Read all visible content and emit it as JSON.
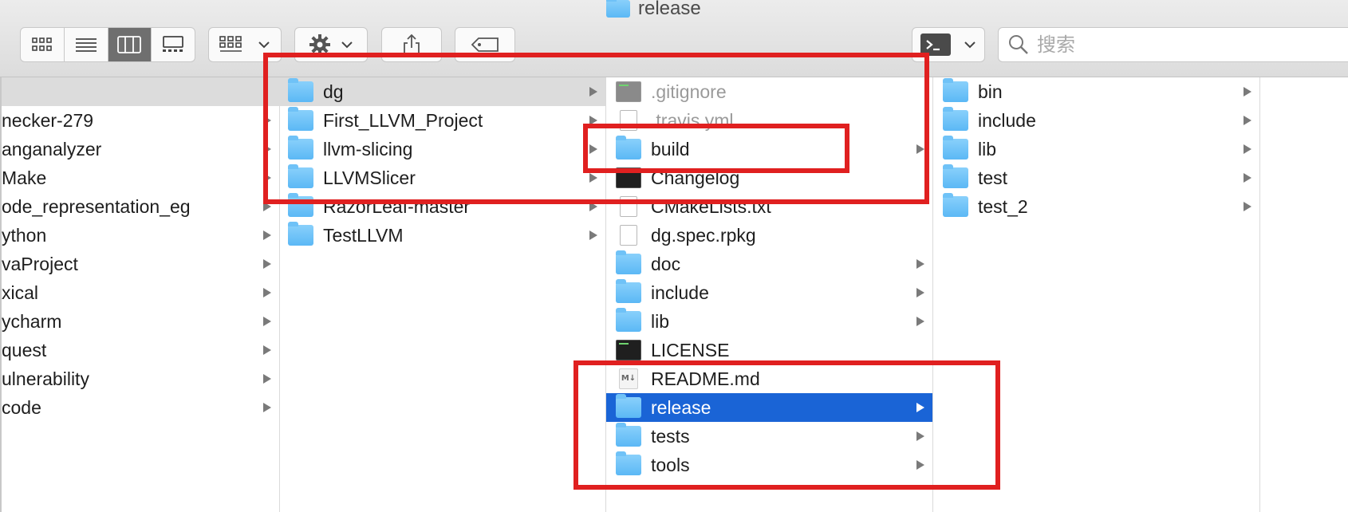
{
  "window": {
    "title": "release"
  },
  "toolbar": {
    "view_modes": [
      "icon-view",
      "list-view",
      "column-view",
      "gallery-view"
    ],
    "active_view": "column-view",
    "search_placeholder": "搜索"
  },
  "columns": [
    {
      "items": [
        {
          "name": "",
          "kind": "none",
          "arrow": false,
          "selected": "gray"
        },
        {
          "name": "necker-279",
          "kind": "none",
          "arrow": true
        },
        {
          "name": "anganalyzer",
          "kind": "none",
          "arrow": true
        },
        {
          "name": "Make",
          "kind": "none",
          "arrow": true
        },
        {
          "name": "ode_representation_eg",
          "kind": "none",
          "arrow": true
        },
        {
          "name": "ython",
          "kind": "none",
          "arrow": true
        },
        {
          "name": "vaProject",
          "kind": "none",
          "arrow": true
        },
        {
          "name": "xical",
          "kind": "none",
          "arrow": true
        },
        {
          "name": "ycharm",
          "kind": "none",
          "arrow": true
        },
        {
          "name": "quest",
          "kind": "none",
          "arrow": true
        },
        {
          "name": "ulnerability",
          "kind": "none",
          "arrow": true
        },
        {
          "name": "code",
          "kind": "none",
          "arrow": true
        }
      ]
    },
    {
      "items": [
        {
          "name": "dg",
          "kind": "folder",
          "arrow": true,
          "selected": "gray"
        },
        {
          "name": "First_LLVM_Project",
          "kind": "folder",
          "arrow": true
        },
        {
          "name": "llvm-slicing",
          "kind": "folder",
          "arrow": true
        },
        {
          "name": "LLVMSlicer",
          "kind": "folder",
          "arrow": true
        },
        {
          "name": "RazorLeaf-master",
          "kind": "folder",
          "arrow": true
        },
        {
          "name": "TestLLVM",
          "kind": "folder",
          "arrow": true
        }
      ]
    },
    {
      "items": [
        {
          "name": ".gitignore",
          "kind": "term-gray",
          "arrow": false,
          "dim": true
        },
        {
          "name": ".travis.yml",
          "kind": "doc",
          "arrow": false,
          "dim": true
        },
        {
          "name": "build",
          "kind": "folder",
          "arrow": true
        },
        {
          "name": "Changelog",
          "kind": "term",
          "arrow": false
        },
        {
          "name": "CMakeLists.txt",
          "kind": "doc",
          "arrow": false
        },
        {
          "name": "dg.spec.rpkg",
          "kind": "doc",
          "arrow": false
        },
        {
          "name": "doc",
          "kind": "folder",
          "arrow": true
        },
        {
          "name": "include",
          "kind": "folder",
          "arrow": true
        },
        {
          "name": "lib",
          "kind": "folder",
          "arrow": true
        },
        {
          "name": "LICENSE",
          "kind": "term",
          "arrow": false
        },
        {
          "name": "README.md",
          "kind": "md",
          "arrow": false
        },
        {
          "name": "release",
          "kind": "folder",
          "arrow": true,
          "selected": "blue"
        },
        {
          "name": "tests",
          "kind": "folder",
          "arrow": true
        },
        {
          "name": "tools",
          "kind": "folder",
          "arrow": true
        }
      ]
    },
    {
      "items": [
        {
          "name": "bin",
          "kind": "folder",
          "arrow": true
        },
        {
          "name": "include",
          "kind": "folder",
          "arrow": true
        },
        {
          "name": "lib",
          "kind": "folder",
          "arrow": true
        },
        {
          "name": "test",
          "kind": "folder",
          "arrow": true
        },
        {
          "name": "test_2",
          "kind": "folder",
          "arrow": true
        }
      ]
    },
    {
      "items": []
    }
  ],
  "annotation_color": "#e02020",
  "md_badge": "M↓"
}
